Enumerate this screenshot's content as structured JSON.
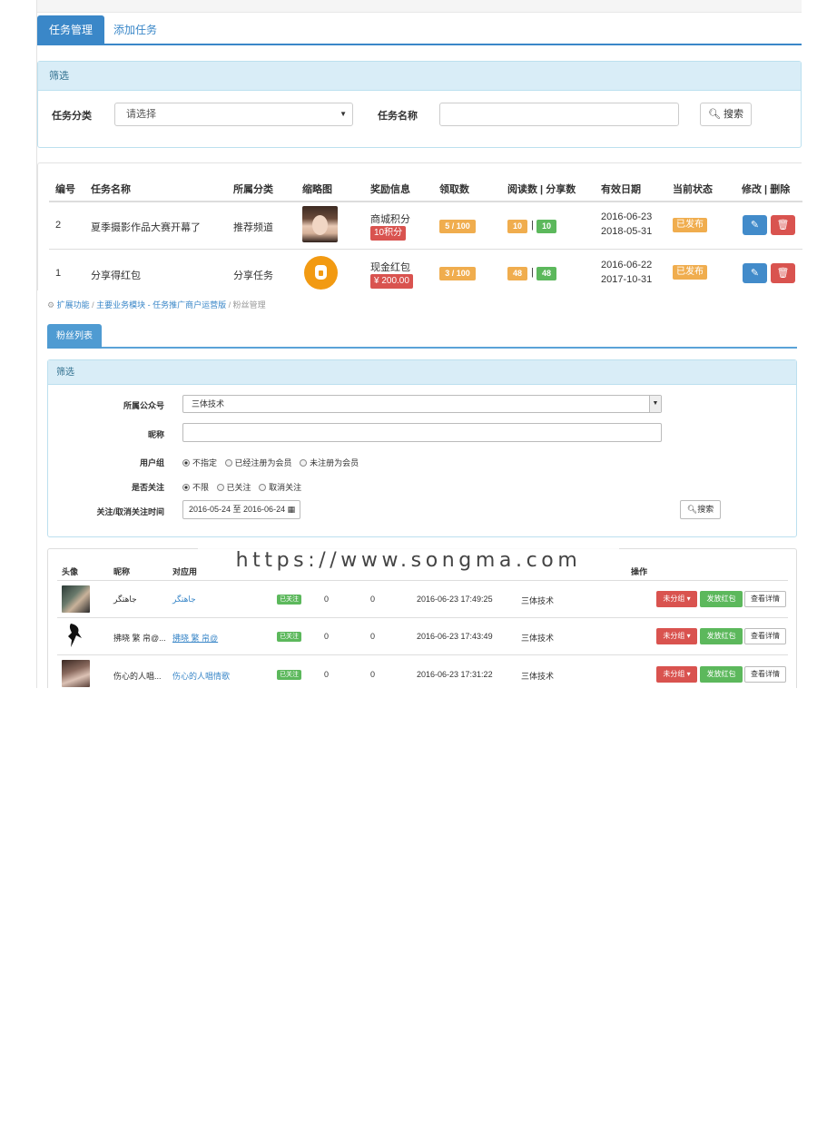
{
  "task_manager": {
    "tabs": [
      {
        "label": "任务管理",
        "active": true
      },
      {
        "label": "添加任务",
        "active": false
      }
    ],
    "filter": {
      "heading": "筛选",
      "category_label": "任务分类",
      "category_value": "请选择",
      "name_label": "任务名称",
      "name_value": "",
      "search_label": "搜索"
    },
    "table": {
      "headers": [
        "编号",
        "任务名称",
        "所属分类",
        "缩略图",
        "奖励信息",
        "领取数",
        "阅读数 | 分享数",
        "有效日期",
        "当前状态",
        "修改 | 删除"
      ],
      "rows": [
        {
          "id": "2",
          "name": "夏季摄影作品大赛开幕了",
          "category": "推荐频道",
          "reward_type": "商城积分",
          "reward_value": "10积分",
          "claimed": "5 / 100",
          "reads": "10",
          "shares": "10",
          "date_start": "2016-06-23",
          "date_end": "2018-05-31",
          "status": "已发布"
        },
        {
          "id": "1",
          "name": "分享得红包",
          "category": "分享任务",
          "reward_type": "现金红包",
          "reward_value": "¥ 200.00",
          "claimed": "3 / 100",
          "reads": "48",
          "shares": "48",
          "date_start": "2016-06-22",
          "date_end": "2017-10-31",
          "status": "已发布"
        }
      ]
    }
  },
  "fans_manager": {
    "breadcrumb": [
      "扩展功能",
      "主要业务模块 - 任务推广商户运营版",
      "粉丝管理"
    ],
    "tab_label": "粉丝列表",
    "filter": {
      "heading": "筛选",
      "account_label": "所属公众号",
      "account_value": "三体技术",
      "nickname_label": "昵称",
      "nickname_value": "",
      "group_label": "用户组",
      "group_options": [
        "不指定",
        "已经注册为会员",
        "未注册为会员"
      ],
      "group_selected": 0,
      "follow_label": "是否关注",
      "follow_options": [
        "不限",
        "已关注",
        "取消关注"
      ],
      "follow_selected": 0,
      "time_label": "关注/取消关注时间",
      "time_value": "2016-05-24 至 2016-06-24",
      "search_label": "搜索"
    },
    "table": {
      "headers": [
        "头像",
        "昵称",
        "对应用",
        "操作"
      ],
      "rows": [
        {
          "nickname": "جاهتگر",
          "user": "جاهتگر",
          "status": "已关注",
          "c1": "0",
          "c2": "0",
          "time": "2016-06-23 17:49:25",
          "account": "三体技术"
        },
        {
          "nickname": "拂晓 繁 帛@...",
          "user": "拂晓 繁 帛@",
          "status": "已关注",
          "c1": "0",
          "c2": "0",
          "time": "2016-06-23 17:43:49",
          "account": "三体技术"
        },
        {
          "nickname": "伤心的人唱...",
          "user": "伤心的人唱情歌",
          "status": "已关注",
          "c1": "0",
          "c2": "0",
          "time": "2016-06-23 17:31:22",
          "account": "三体技术"
        }
      ],
      "actions": {
        "group": "未分组",
        "send": "发放红包",
        "detail": "查看详情"
      }
    }
  },
  "watermark": "https://www.songma.com",
  "colors": {
    "primary": "#428bca",
    "danger": "#d9534f",
    "warning": "#f0ad4e",
    "success": "#5cb85c",
    "panel_head": "#d9edf7"
  }
}
